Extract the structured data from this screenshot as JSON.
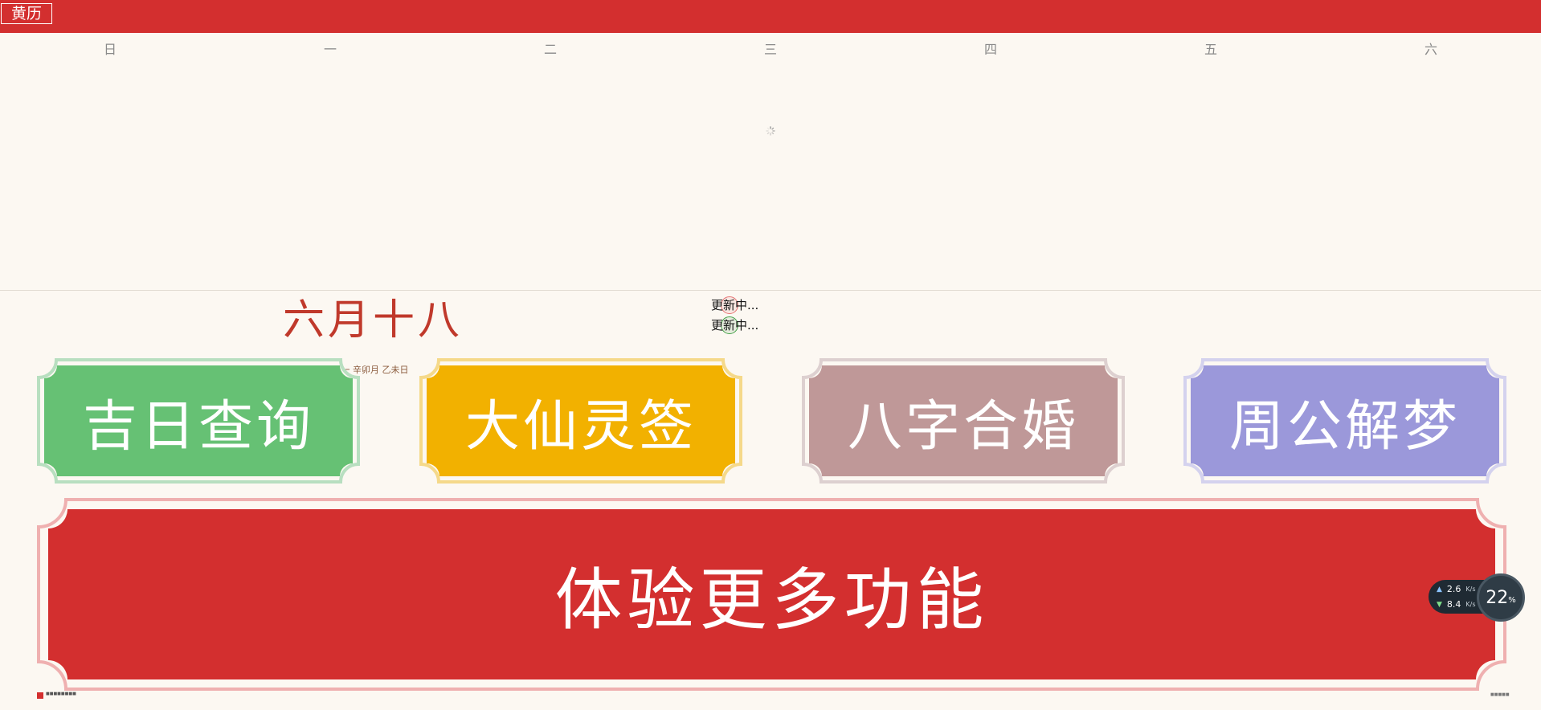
{
  "header": {
    "tab_label": "黄历",
    "colors": {
      "bar": "#d32f2f"
    }
  },
  "weekdays": [
    "日",
    "一",
    "二",
    "三",
    "四",
    "五",
    "六"
  ],
  "date": {
    "lunar": "六月十八",
    "sub": "年 星期一 辛卯月 乙未日"
  },
  "status": {
    "line1": "更新中...",
    "line2": "更新中..."
  },
  "cards": [
    {
      "label": "吉日查询",
      "color": "#66c174",
      "border": "#b8dfc0"
    },
    {
      "label": "大仙灵签",
      "color": "#f2b100",
      "border": "#f5d98a"
    },
    {
      "label": "八字合婚",
      "color": "#bf9898",
      "border": "#ddd0d0"
    },
    {
      "label": "周公解梦",
      "color": "#9b98da",
      "border": "#d4d2ee"
    }
  ],
  "big_card": {
    "label": "体验更多功能",
    "color": "#d32f2f",
    "border": "#efb0b0"
  },
  "network": {
    "up": "2.6",
    "up_unit": "K/s",
    "down": "8.4",
    "down_unit": "K/s",
    "cpu": "22",
    "cpu_unit": "%"
  }
}
